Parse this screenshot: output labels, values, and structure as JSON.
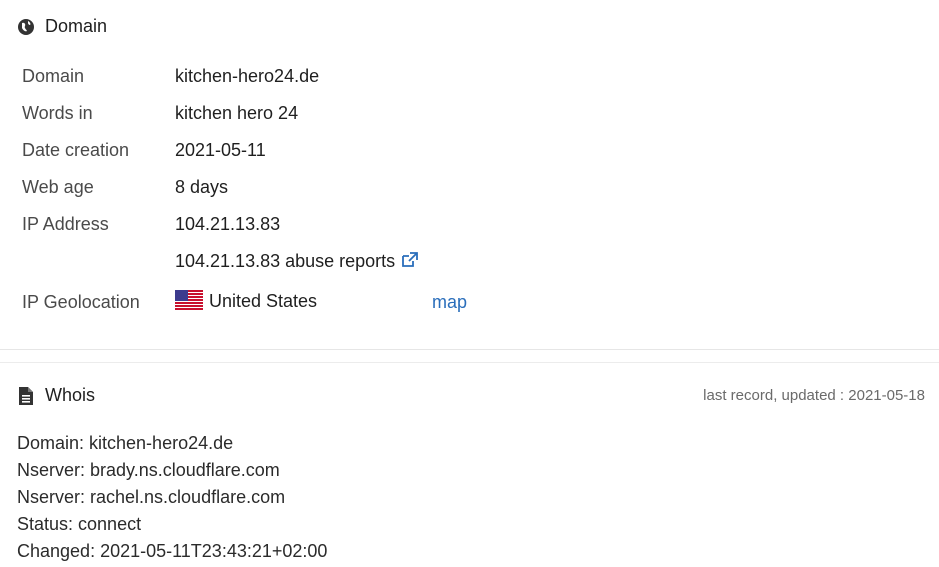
{
  "domain_section": {
    "title": "Domain",
    "icon": "globe-icon",
    "rows": [
      {
        "label": "Domain",
        "value": "kitchen-hero24.de"
      },
      {
        "label": "Words in",
        "value": "kitchen hero 24"
      },
      {
        "label": "Date creation",
        "value": "2021-05-11"
      },
      {
        "label": "Web age",
        "value": "8 days"
      },
      {
        "label": "IP Address",
        "value": "104.21.13.83"
      }
    ],
    "abuse_link": "104.21.13.83 abuse reports",
    "geo": {
      "label": "IP Geolocation",
      "country": "United States",
      "map_link": "map"
    },
    "link_color": "#2a6ebb"
  },
  "whois_section": {
    "title": "Whois",
    "icon": "document-icon",
    "updated": "last record, updated : 2021-05-18",
    "lines": [
      "Domain: kitchen-hero24.de",
      "Nserver: brady.ns.cloudflare.com",
      "Nserver: rachel.ns.cloudflare.com",
      "Status: connect",
      "Changed: 2021-05-11T23:43:21+02:00"
    ]
  }
}
